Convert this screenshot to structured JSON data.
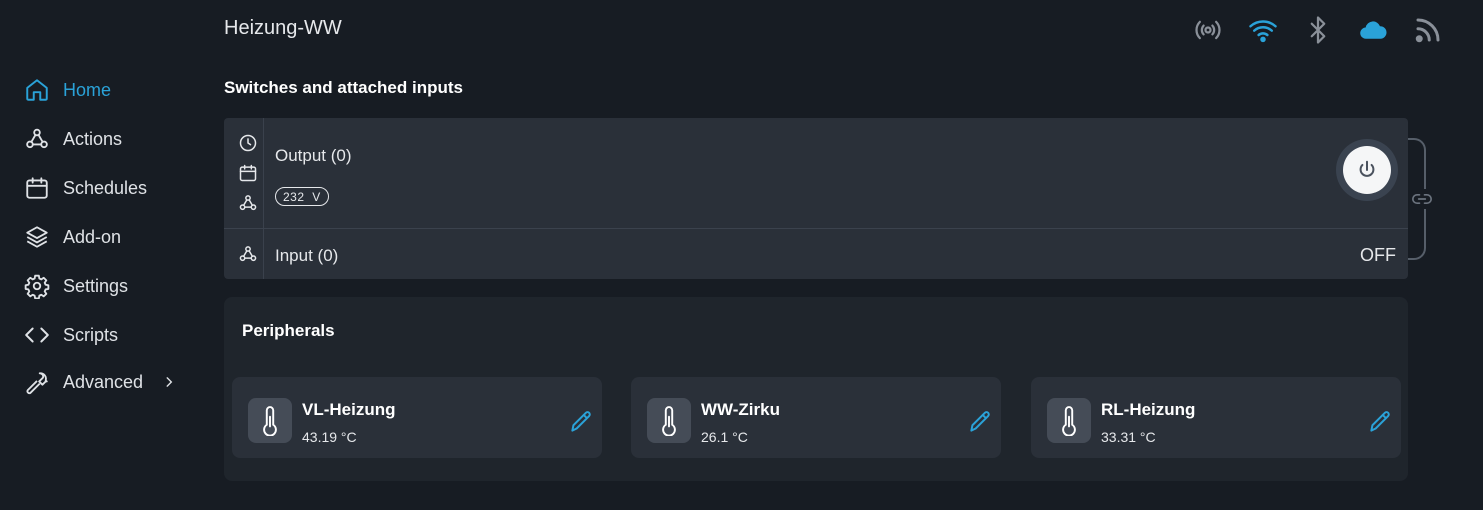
{
  "header": {
    "device_name": "Heizung-WW",
    "status_icons": [
      {
        "name": "radio-signal-icon",
        "color": "#8a9099"
      },
      {
        "name": "wifi-icon",
        "color": "#2aa2d8"
      },
      {
        "name": "bluetooth-icon",
        "color": "#8a9099"
      },
      {
        "name": "cloud-icon",
        "color": "#2aa2d8"
      },
      {
        "name": "rss-icon",
        "color": "#8a9099"
      }
    ]
  },
  "sidebar": {
    "items": [
      {
        "label": "Home",
        "icon": "home-icon",
        "active": true
      },
      {
        "label": "Actions",
        "icon": "webhook-icon"
      },
      {
        "label": "Schedules",
        "icon": "calendar-icon"
      },
      {
        "label": "Add-on",
        "icon": "layers-icon"
      },
      {
        "label": "Settings",
        "icon": "gear-icon"
      },
      {
        "label": "Scripts",
        "icon": "code-icon"
      },
      {
        "label": "Advanced",
        "icon": "wrench-icon"
      }
    ]
  },
  "switches": {
    "section_title": "Switches and attached inputs",
    "output_label": "Output (0)",
    "voltage": "232  V",
    "input_label": "Input (0)",
    "input_state": "OFF"
  },
  "peripherals": {
    "title": "Peripherals",
    "items": [
      {
        "name": "VL-Heizung",
        "value": "43.19 °C"
      },
      {
        "name": "WW-Zirku",
        "value": "26.1 °C"
      },
      {
        "name": "RL-Heizung",
        "value": "33.31 °C"
      }
    ]
  },
  "colors": {
    "accent": "#2aa2d8",
    "background": "#171c23",
    "card": "#2a3039"
  }
}
